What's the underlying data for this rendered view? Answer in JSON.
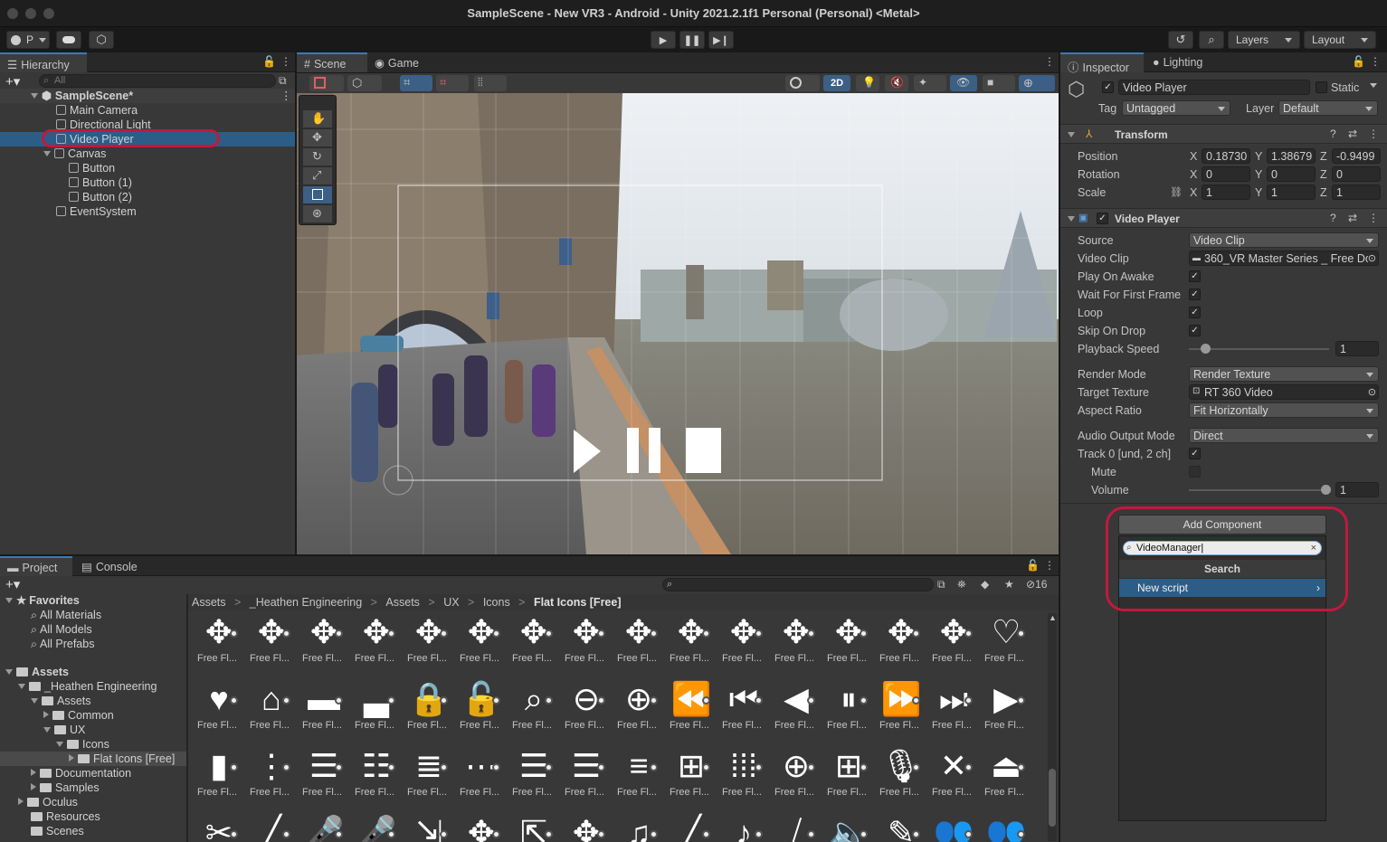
{
  "window": {
    "title": "SampleScene - New VR3 - Android - Unity 2021.2.1f1 Personal (Personal) <Metal>"
  },
  "toolbar": {
    "account": "P",
    "layers": "Layers",
    "layout": "Layout"
  },
  "hierarchy": {
    "tab": "Hierarchy",
    "search_placeholder": "All",
    "scene": "SampleScene*",
    "items": [
      "Main Camera",
      "Directional Light",
      "Video Player",
      "Canvas",
      "Button",
      "Button (1)",
      "Button (2)",
      "EventSystem"
    ]
  },
  "scene": {
    "tabs": [
      "Scene",
      "Game"
    ],
    "mode_2d": "2D"
  },
  "inspector": {
    "tabs": [
      "Inspector",
      "Lighting"
    ],
    "object_name": "Video Player",
    "static_label": "Static",
    "tag_label": "Tag",
    "tag_value": "Untagged",
    "layer_label": "Layer",
    "layer_value": "Default",
    "transform": {
      "title": "Transform",
      "position_label": "Position",
      "position": [
        "0.18730",
        "1.38679",
        "-0.9499"
      ],
      "rotation_label": "Rotation",
      "rotation": [
        "0",
        "0",
        "0"
      ],
      "scale_label": "Scale",
      "scale": [
        "1",
        "1",
        "1"
      ],
      "axes": [
        "X",
        "Y",
        "Z"
      ]
    },
    "video_player": {
      "title": "Video Player",
      "source_label": "Source",
      "source": "Video Clip",
      "clip_label": "Video Clip",
      "clip": "360_VR Master Series _ Free Dc",
      "play_on_awake": "Play On Awake",
      "wait_first_frame": "Wait For First Frame",
      "loop": "Loop",
      "skip_on_drop": "Skip On Drop",
      "playback_speed_label": "Playback Speed",
      "playback_speed": "1",
      "render_mode_label": "Render Mode",
      "render_mode": "Render Texture",
      "target_texture_label": "Target Texture",
      "target_texture": "RT 360 Video",
      "aspect_ratio_label": "Aspect Ratio",
      "aspect_ratio": "Fit Horizontally",
      "audio_output_label": "Audio Output Mode",
      "audio_output": "Direct",
      "track_label": "Track 0 [und, 2 ch]",
      "mute_label": "Mute",
      "volume_label": "Volume",
      "volume": "1"
    },
    "add_component": {
      "button": "Add Component",
      "search_value": "VideoManager",
      "search_header": "Search",
      "new_script": "New script"
    }
  },
  "project": {
    "tabs": [
      "Project",
      "Console"
    ],
    "search_count": "16",
    "favorites_label": "Favorites",
    "favorites": [
      "All Materials",
      "All Models",
      "All Prefabs"
    ],
    "assets_label": "Assets",
    "tree": [
      "_Heathen Engineering",
      "Assets",
      "Common",
      "UX",
      "Icons",
      "Flat Icons [Free]",
      "Documentation",
      "Samples",
      "Oculus",
      "Resources",
      "Scenes"
    ],
    "breadcrumb": [
      "Assets",
      "_Heathen Engineering",
      "Assets",
      "UX",
      "Icons",
      "Flat Icons [Free]"
    ],
    "asset_label": "Free Fl..."
  }
}
